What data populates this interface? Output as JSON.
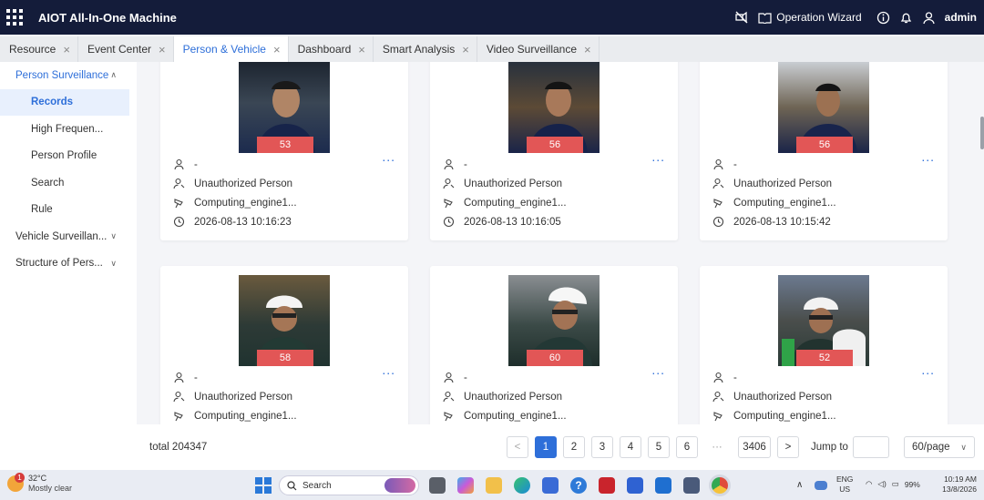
{
  "app": {
    "title": "AIOT All-In-One Machine",
    "operation_wizard": "Operation Wizard",
    "user": "admin"
  },
  "tabs": [
    {
      "label": "Resource"
    },
    {
      "label": "Event Center"
    },
    {
      "label": "Person & Vehicle",
      "active": true
    },
    {
      "label": "Dashboard"
    },
    {
      "label": "Smart Analysis"
    },
    {
      "label": "Video Surveillance"
    }
  ],
  "sidebar": {
    "person_surveillance": "Person Surveillance",
    "records": "Records",
    "high_frequency": "High Frequen...",
    "person_profile": "Person Profile",
    "search": "Search",
    "rule": "Rule",
    "vehicle_surveillance": "Vehicle Surveillan...",
    "structure": "Structure of Pers..."
  },
  "records": [
    {
      "score": "53",
      "name": "-",
      "type": "Unauthorized Person",
      "device": "Computing_engine1...",
      "time": "2026-08-13 10:16:23"
    },
    {
      "score": "56",
      "name": "-",
      "type": "Unauthorized Person",
      "device": "Computing_engine1...",
      "time": "2026-08-13 10:16:05"
    },
    {
      "score": "56",
      "name": "-",
      "type": "Unauthorized Person",
      "device": "Computing_engine1...",
      "time": "2026-08-13 10:15:42"
    },
    {
      "score": "58",
      "name": "-",
      "type": "Unauthorized Person",
      "device": "Computing_engine1..."
    },
    {
      "score": "60",
      "name": "-",
      "type": "Unauthorized Person",
      "device": "Computing_engine1..."
    },
    {
      "score": "52",
      "name": "-",
      "type": "Unauthorized Person",
      "device": "Computing_engine1..."
    }
  ],
  "more_label": "...",
  "pagination": {
    "total": "total 204347",
    "pages": [
      "1",
      "2",
      "3",
      "4",
      "5",
      "6"
    ],
    "ellipsis": "···",
    "last": "3406",
    "jump_label": "Jump to",
    "page_size": "60/page",
    "prev": "<",
    "next": ">"
  },
  "taskbar": {
    "temp": "32°C",
    "weather": "Mostly clear",
    "search": "Search",
    "lang": "ENG",
    "region": "US",
    "battery": "99%",
    "time": "10:19 AM",
    "date": "13/8/2026",
    "notif": "1"
  }
}
